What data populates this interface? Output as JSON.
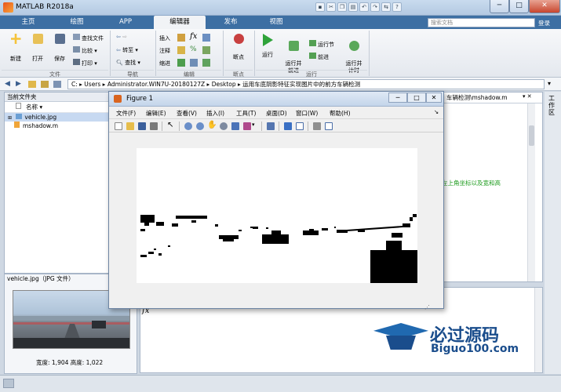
{
  "window": {
    "title": "MATLAB R2018a",
    "minimize": "─",
    "maximize": "□",
    "close": "✕"
  },
  "tabs": [
    "主页",
    "绘图",
    "APP",
    "编辑器",
    "发布",
    "视图"
  ],
  "search": {
    "placeholder": "搜索文档"
  },
  "signin": "登录",
  "ribbon": {
    "new": "新建",
    "open": "打开",
    "save": "保存",
    "find_files": "查找文件",
    "compare": "比较",
    "print": "打印",
    "goto": "转至",
    "find": "查找",
    "insert": "插入",
    "comment": "注释",
    "indent": "缩进",
    "breakpoints": "断点",
    "run": "运行",
    "run_advance": "运行并\n前进",
    "run_section": "运行节",
    "advance": "前进",
    "run_time": "运行并\n计时",
    "groups": [
      "文件",
      "导航",
      "编辑",
      "断点",
      "运行"
    ]
  },
  "address": {
    "path": "C:  ▸  Users  ▸  Administrator.WIN7U-20180127Z  ▸  Desktop  ▸  运用车底阴影特征实现图片中的前方车辆检测"
  },
  "current_folder": {
    "title": "当前文件夹",
    "column": "名称",
    "files": [
      {
        "name": "vehicle.jpg",
        "selected": true
      },
      {
        "name": "mshadow.m",
        "selected": false
      }
    ]
  },
  "details": {
    "title": "vehicle.jpg（JPG 文件）",
    "size": "宽度: 1,904  高度: 1,022"
  },
  "editor": {
    "tab_path": "车辆检测\\mshadow.m",
    "comment": "左上角坐标以及宽和高"
  },
  "workspace_label": "工作区",
  "figure": {
    "title": "Figure 1",
    "menu": [
      "文件(F)",
      "编辑(E)",
      "查看(V)",
      "插入(I)",
      "工具(T)",
      "桌面(D)",
      "窗口(W)",
      "帮助(H)"
    ]
  },
  "watermark": {
    "line1": "必过源码",
    "line2": "Biguo100.com"
  },
  "colors": {
    "accent": "#3d6fa3",
    "run_green": "#2fa33a"
  }
}
